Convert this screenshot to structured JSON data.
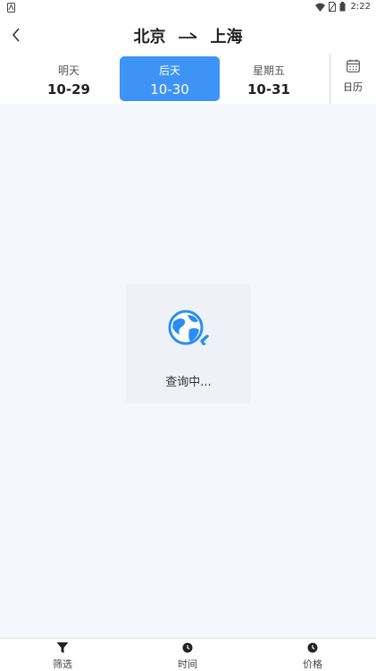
{
  "status_bar": {
    "time": "2:22"
  },
  "header": {
    "from_city": "北京",
    "arrow": "→",
    "to_city": "上海"
  },
  "date_tabs": [
    {
      "day": "明天",
      "date": "10-29",
      "selected": false
    },
    {
      "day": "后天",
      "date": "10-30",
      "selected": true
    },
    {
      "day": "星期五",
      "date": "10-31",
      "selected": false
    }
  ],
  "calendar": {
    "label": "日历",
    "icon": "calendar-icon"
  },
  "loading": {
    "text": "查询中...",
    "icon": "globe-icon"
  },
  "bottom_bar": {
    "items": [
      {
        "label": "筛选",
        "icon": "filter-icon"
      },
      {
        "label": "时间",
        "icon": "clock-icon"
      },
      {
        "label": "价格",
        "icon": "clock-icon"
      }
    ]
  },
  "colors": {
    "accent": "#3d94f6",
    "background": "#f4f8fd",
    "globe": "#2b8ef0"
  }
}
